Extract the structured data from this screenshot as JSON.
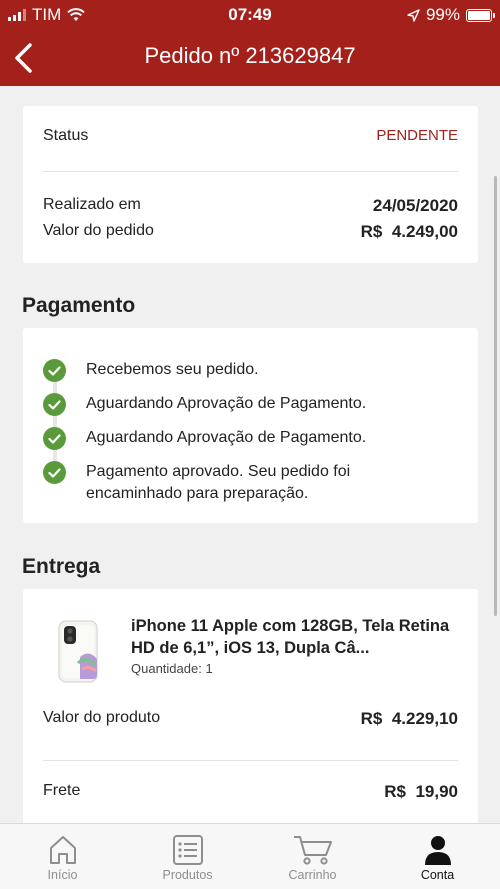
{
  "status_bar": {
    "carrier": "TIM",
    "time": "07:49",
    "battery": "99%"
  },
  "header": {
    "title": "Pedido nº 213629847",
    "back_icon": "chevron-left-icon"
  },
  "order": {
    "status_label": "Status",
    "status_value": "PENDENTE",
    "status_color": "#a3201b",
    "date_label": "Realizado em",
    "date_value": "24/05/2020",
    "total_label": "Valor do pedido",
    "total_value": "R$  4.249,00"
  },
  "payment": {
    "title": "Pagamento",
    "steps": [
      "Recebemos seu pedido.",
      "Aguardando Aprovação de Pagamento.",
      "Aguardando Aprovação de Pagamento.",
      "Pagamento aprovado. Seu pedido foi encaminhado para preparação."
    ]
  },
  "delivery": {
    "title": "Entrega",
    "product_name": "iPhone 11 Apple com 128GB, Tela Retina HD de 6,1”, iOS 13, Dupla Câ...",
    "quantity": "Quantidade: 1",
    "product_value_label": "Valor do produto",
    "product_value": "R$  4.229,10",
    "shipping_label": "Frete",
    "shipping_value": "R$  19,90"
  },
  "tabs": [
    {
      "label": "Início",
      "icon": "home-icon"
    },
    {
      "label": "Produtos",
      "icon": "list-icon"
    },
    {
      "label": "Carrinho",
      "icon": "cart-icon"
    },
    {
      "label": "Conta",
      "icon": "user-icon",
      "active": true
    }
  ],
  "colors": {
    "brand": "#a3201b",
    "success": "#5a9a3c"
  }
}
